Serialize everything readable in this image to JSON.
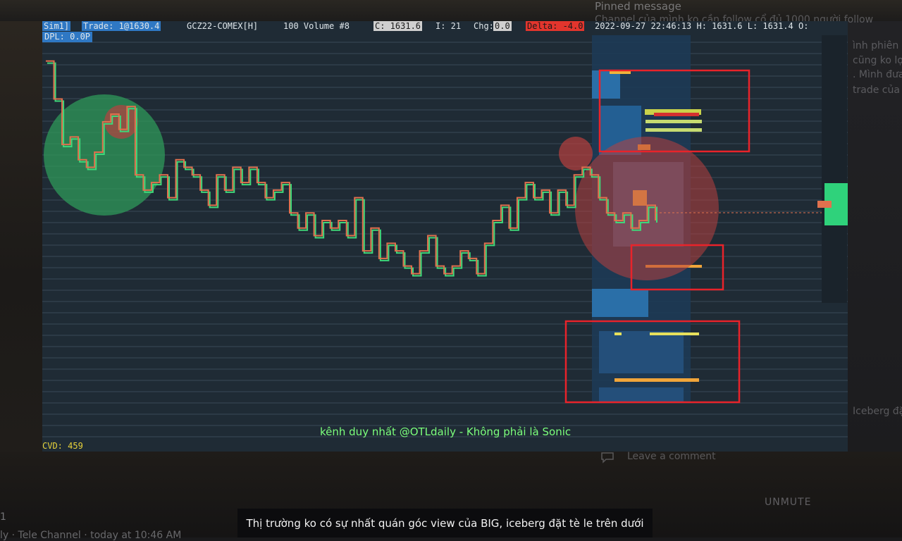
{
  "header": {
    "sim": "Sim1]",
    "trade": "Trade: 1@1630.4",
    "symbol": "GCZ22-COMEX[H]",
    "volume": "100 Volume  #8",
    "close": "C: 1631.6",
    "i_val": "I: 21",
    "chg_label": "Chg:",
    "chg_val": "0.0",
    "delta": "Delta: -4.0",
    "time_hl": "2022-09-27 22:46:13 H: 1631.6 L: 1631.4 O:"
  },
  "pnl": "DPL: 0.0P",
  "cvd": "CVD: 459",
  "watermark": "kênh duy nhất @OTLdaily - Không phải là Sonic",
  "caption": "Thị trường ko có sự nhất quán góc view của BIG, iceberg đặt tè le trên dưới",
  "side_panel": {
    "pinned_title": "Pinned message",
    "pinned_text": "Channel của mình ko cần follow cổ đủ 1000 người follow",
    "frag1": "ình phiên c",
    "frag2": "cũng ko lợ",
    "frag3": ". Mình đưa",
    "frag4": "trade của",
    "frag5": "Iceberg đặ",
    "leave_comment": "Leave a comment",
    "unmute": "UNMUTE"
  },
  "footer": {
    "line1": "1",
    "line2": "ly · Tele Channel · today at 10:46 AM"
  },
  "colors": {
    "chart_bg": "#1f2b35",
    "up": "#3fd87a",
    "down": "#e0714e",
    "box": "#e8232a",
    "bubble_green": "#2f9a5a",
    "bubble_red": "#b8403e"
  },
  "chart_data": {
    "type": "line",
    "title": "",
    "series": [
      {
        "values": [
          1633.0,
          1632.5,
          1631.9,
          1632.0,
          1631.7,
          1631.6,
          1631.8,
          1632.2,
          1632.3,
          1632.1,
          1632.4,
          1631.5,
          1631.3,
          1631.4,
          1631.5,
          1631.2,
          1631.7,
          1631.6,
          1631.5,
          1631.3,
          1631.1,
          1631.5,
          1631.3,
          1631.6,
          1631.4,
          1631.6,
          1631.4,
          1631.2,
          1631.3,
          1631.4,
          1631.0,
          1630.8,
          1631.0,
          1630.7,
          1630.9,
          1630.8,
          1630.9,
          1630.7,
          1631.2,
          1630.5,
          1630.8,
          1630.4,
          1630.6,
          1630.5,
          1630.3,
          1630.2,
          1630.5,
          1630.7,
          1630.3,
          1630.2,
          1630.3,
          1630.5,
          1630.4,
          1630.2,
          1630.6,
          1630.9,
          1631.1,
          1630.8,
          1631.2,
          1631.4,
          1631.2,
          1631.3,
          1631.0,
          1631.3,
          1631.1,
          1631.5,
          1631.6,
          1631.5,
          1631.2,
          1631.0,
          1630.9,
          1631.0,
          1630.8,
          1630.9,
          1631.1,
          1630.9
        ]
      }
    ],
    "last_price": 1631.4,
    "cvd": 459
  }
}
